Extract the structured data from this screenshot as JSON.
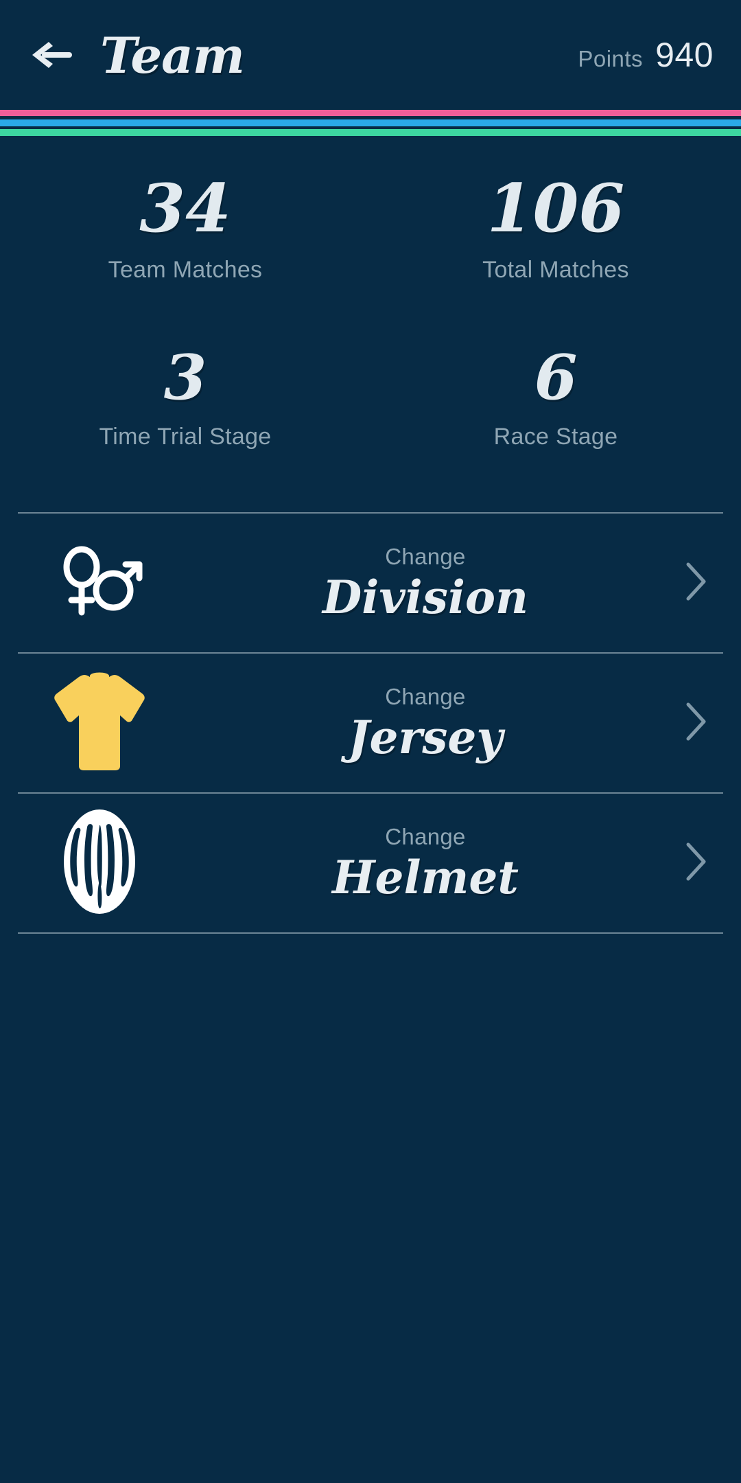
{
  "theme": {
    "background": "#072B45",
    "text_primary": "#E8EEF2",
    "text_muted": "#8FA6B4",
    "divider": "#7E95A3",
    "stripe_pink": "#EE5E99",
    "stripe_blue": "#2AA9E8",
    "stripe_teal": "#3DD6A0",
    "jersey_yellow": "#F9D05C",
    "helmet_white": "#FFFFFF"
  },
  "header": {
    "back_icon": "arrow-left-icon",
    "title": "Team",
    "points_label": "Points",
    "points_value": "940"
  },
  "stats": [
    {
      "value": "34",
      "label": "Team Matches"
    },
    {
      "value": "106",
      "label": "Total Matches"
    },
    {
      "value": "3",
      "label": "Time Trial Stage"
    },
    {
      "value": "6",
      "label": "Race Stage"
    }
  ],
  "actions": [
    {
      "sub": "Change",
      "title": "Division",
      "icon": "gender-symbols-icon",
      "chevron": "chevron-right-icon"
    },
    {
      "sub": "Change",
      "title": "Jersey",
      "icon": "jersey-shirt-icon",
      "chevron": "chevron-right-icon"
    },
    {
      "sub": "Change",
      "title": "Helmet",
      "icon": "bike-helmet-icon",
      "chevron": "chevron-right-icon"
    }
  ]
}
